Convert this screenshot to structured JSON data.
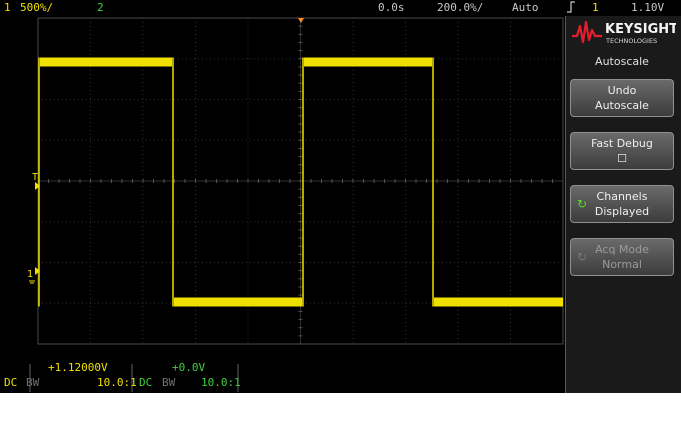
{
  "status_bar": {
    "ch1_number": "1",
    "ch1_scale": "500%/",
    "ch2_number": "2",
    "time_position": "0.0s",
    "time_scale": "200.0%/",
    "trigger_mode": "Auto",
    "trigger_slope_icon": "rising-edge-icon",
    "trigger_source": "1",
    "trigger_level": "1.10V"
  },
  "markers": {
    "trigger_level_marker": "T",
    "ch1_ground_marker": "1"
  },
  "bottom_info": {
    "ch1_offset": "+1.12000V",
    "ch1_coupling": "DC",
    "ch1_bw": "BW",
    "ch1_probe": "10.0:1",
    "ch2_offset": "+0.0V",
    "ch2_coupling": "DC",
    "ch2_bw": "BW",
    "ch2_probe": "10.0:1"
  },
  "brand": {
    "name": "KEYSIGHT",
    "sub": "TECHNOLOGIES",
    "logo_color": "#e5202e"
  },
  "menu": {
    "title": "Autoscale",
    "softkeys": [
      {
        "line1": "Undo",
        "line2": "Autoscale",
        "icon": ""
      },
      {
        "line1": "Fast Debug",
        "line2": "☐",
        "icon": ""
      },
      {
        "line1": "Channels",
        "line2": "Displayed",
        "icon": "rotate-knob-icon"
      },
      {
        "line1": "Acq Mode",
        "line2": "Normal",
        "icon": "rotate-knob-icon"
      }
    ]
  },
  "colors": {
    "ch1": "#f0e000",
    "ch2": "#40d040",
    "grid": "#3a3a3a",
    "knob_active": "#50e020"
  }
}
